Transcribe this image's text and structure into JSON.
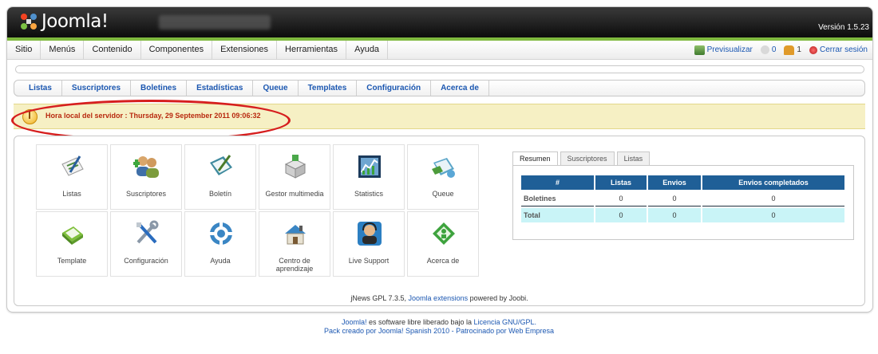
{
  "header": {
    "logo_text": "Joomla!",
    "version": "Versión 1.5.23"
  },
  "menu": {
    "items": [
      "Sitio",
      "Menús",
      "Contenido",
      "Componentes",
      "Extensiones",
      "Herramientas",
      "Ayuda"
    ],
    "right": {
      "preview": "Previsualizar",
      "messages_count": "0",
      "users_count": "1",
      "logout": "Cerrar sesión"
    }
  },
  "subnav": {
    "items": [
      "Listas",
      "Suscriptores",
      "Boletines",
      "Estadísticas",
      "Queue",
      "Templates",
      "Configuración",
      "Acerca de"
    ]
  },
  "notice": {
    "text": "Hora local del servidor : Thursday, 29 September 2011 09:06:32"
  },
  "tiles": [
    {
      "label": "Listas",
      "icon": "lists-icon"
    },
    {
      "label": "Suscriptores",
      "icon": "subscribers-icon"
    },
    {
      "label": "Boletín",
      "icon": "newsletter-icon"
    },
    {
      "label": "Gestor multimedia",
      "icon": "media-manager-icon"
    },
    {
      "label": "Statistics",
      "icon": "statistics-icon"
    },
    {
      "label": "Queue",
      "icon": "queue-icon"
    },
    {
      "label": "Template",
      "icon": "template-icon"
    },
    {
      "label": "Configuración",
      "icon": "configuration-icon"
    },
    {
      "label": "Ayuda",
      "icon": "help-icon"
    },
    {
      "label": "Centro de aprendizaje",
      "icon": "learning-center-icon"
    },
    {
      "label": "Live Support",
      "icon": "live-support-icon"
    },
    {
      "label": "Acerca de",
      "icon": "about-icon"
    }
  ],
  "summary": {
    "tabs": [
      "Resumen",
      "Suscriptores",
      "Listas"
    ],
    "active_tab": "Resumen",
    "headers": [
      "#",
      "Listas",
      "Envios",
      "Envios completados"
    ],
    "rows": [
      {
        "label": "Boletines",
        "values": [
          "0",
          "0",
          "0"
        ]
      },
      {
        "label": "Total",
        "values": [
          "0",
          "0",
          "0"
        ]
      }
    ]
  },
  "powered": {
    "prefix": "jNews GPL 7.3.5, ",
    "link": "Joomla extensions",
    "suffix": " powered by Joobi."
  },
  "footer": {
    "line1_link1": "Joomla!",
    "line1_text": " es software libre liberado bajo la ",
    "line1_link2": "Licencia GNU/GPL.",
    "line2_text": "Pack creado por Joomla! Spanish 2010 - Patrocinado por Web Empresa"
  },
  "colors": {
    "accent_green": "#7fb93e",
    "link_blue": "#1b57b1",
    "table_header": "#1f5f97",
    "notice_bg": "#f6f0c4",
    "notice_text": "#b8290f",
    "annotation_red": "#d61e1e"
  }
}
